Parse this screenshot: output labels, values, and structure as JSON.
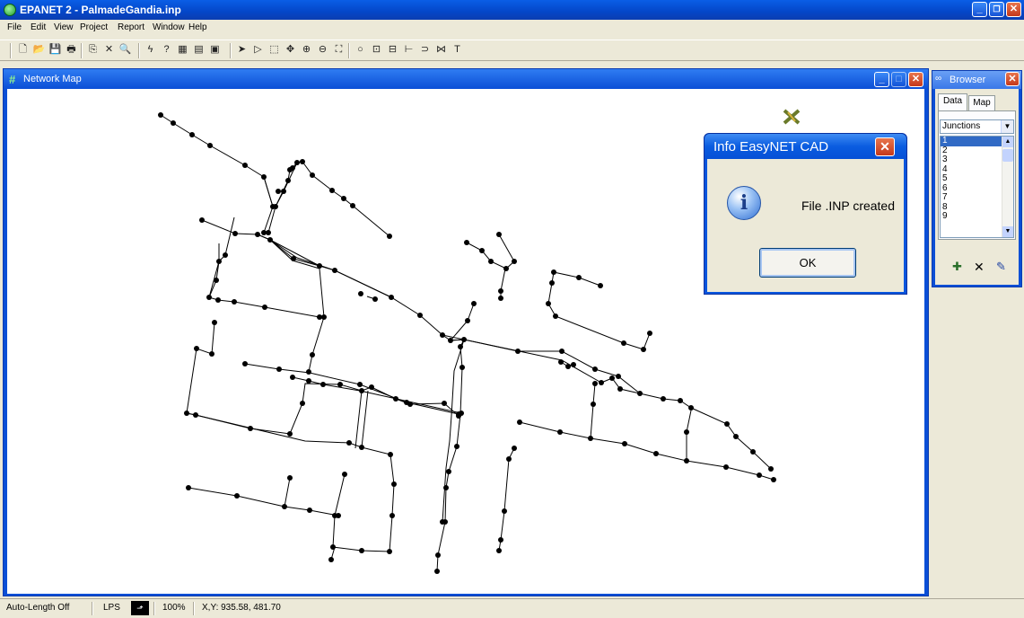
{
  "app": {
    "title": "EPANET 2 - PalmadeGandia.inp",
    "minimize": "_",
    "restore": "❐",
    "close": "✕"
  },
  "menu": [
    "File",
    "Edit",
    "View",
    "Project",
    "Report",
    "Window",
    "Help"
  ],
  "toolbar": {
    "icons": [
      "new-icon",
      "open-icon",
      "save-icon",
      "print-icon",
      "copy-icon",
      "delete-icon",
      "find-icon",
      "run-icon",
      "query-icon",
      "graph-icon",
      "table-icon",
      "options-icon",
      "select-object-icon",
      "select-vertex-icon",
      "select-region-icon",
      "pan-icon",
      "zoom-in-icon",
      "zoom-out-icon",
      "full-extent-icon",
      "add-junction-icon",
      "add-reservoir-icon",
      "add-tank-icon",
      "add-pipe-icon",
      "add-pump-icon",
      "add-valve-icon",
      "add-label-icon"
    ],
    "glyphs": [
      "🗋",
      "📂",
      "💾",
      "🖶",
      "⎘",
      "✕",
      "🔍",
      "ϟ",
      "?",
      "▦",
      "▤",
      "▣",
      "➤",
      "▷",
      "⬚",
      "✥",
      "⊕",
      "⊖",
      "⛶",
      "○",
      "⊡",
      "⊟",
      "⊢",
      "⊃",
      "⋈",
      "T"
    ]
  },
  "network_map": {
    "title": "Network Map",
    "minimize": "_",
    "maximize": "□",
    "close": "✕",
    "legend_icon": "✖"
  },
  "browser": {
    "title": "Browser",
    "close": "✕",
    "tabs": [
      "Data",
      "Map"
    ],
    "category": "Junctions",
    "items": [
      "1",
      "2",
      "3",
      "4",
      "5",
      "6",
      "7",
      "8",
      "9"
    ],
    "add_icon": "✚",
    "delete_icon": "✕",
    "edit_icon": "✎"
  },
  "dialog": {
    "title": "Info EasyNET CAD",
    "close": "✕",
    "icon": "i",
    "message": "File .INP created",
    "ok_label": "OK"
  },
  "status": {
    "auto_length": "Auto-Length Off",
    "units": "LPS",
    "zoom": "100%",
    "coords": "X,Y: 935.58, 481.70"
  },
  "colors": {
    "titlebar": "#0b4fd6",
    "window_bg": "#ece9d8",
    "map_bg": "#ffffff",
    "network": "#000000",
    "close_button": "#c4381b"
  }
}
